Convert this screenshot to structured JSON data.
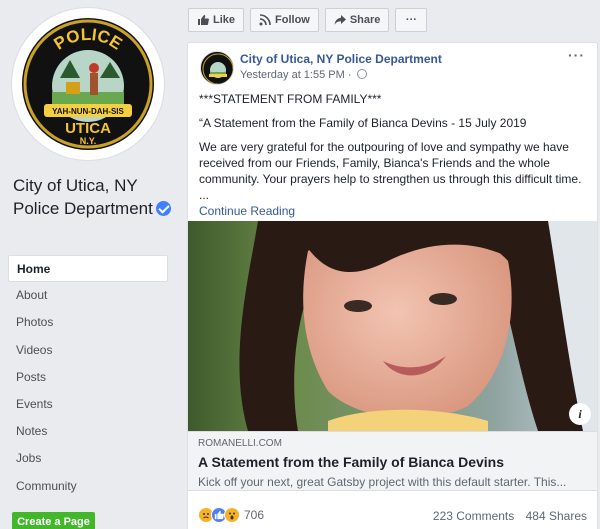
{
  "page": {
    "name": "City of Utica, NY Police Department",
    "badge": {
      "top_text": "POLICE",
      "ribbon_text": "YAH-NUN-DAH-SIS",
      "city_text": "UTICA",
      "state_text": "N.Y."
    }
  },
  "nav": {
    "items": [
      "Home",
      "About",
      "Photos",
      "Videos",
      "Posts",
      "Events",
      "Notes",
      "Jobs",
      "Community"
    ],
    "active": "Home"
  },
  "create_page_label": "Create a Page",
  "actions": {
    "like": "Like",
    "follow": "Follow",
    "share": "Share",
    "more": "···"
  },
  "post": {
    "author": "City of Utica, NY Police Department",
    "time": "Yesterday at 1:55 PM · ",
    "menu": "···",
    "line1": "***STATEMENT FROM FAMILY***",
    "line2": "“A Statement from the Family of Bianca Devins - 15 July 2019",
    "line3": "We are very grateful for the outpouring of love and sympathy we have received from our Friends, Family, Bianca's Friends and the whole community. Your prayers help to strengthen us through this difficult time.",
    "ellipsis": "...",
    "continue": "Continue Reading",
    "link": {
      "domain": "ROMANELLI.COM",
      "title": "A Statement from the Family of Bianca Devins",
      "description": "Kick off your next, great Gatsby project with this default starter. This..."
    },
    "info_icon": "i",
    "reactions_count": "706",
    "comments": "223 Comments",
    "shares": "484 Shares"
  },
  "colors": {
    "link_blue": "#365899",
    "create_green": "#42b72a",
    "verified_blue": "#4080ff"
  }
}
